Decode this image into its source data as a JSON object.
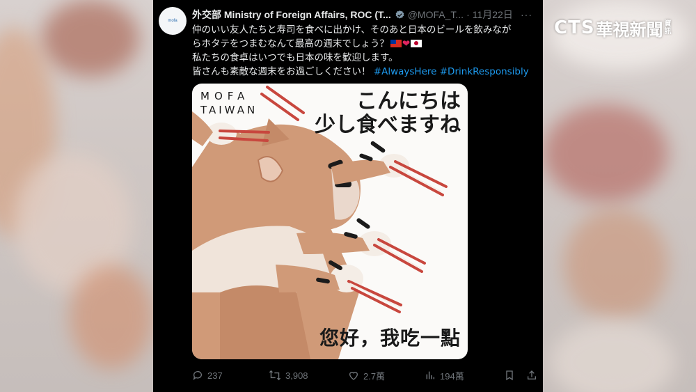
{
  "tweet": {
    "avatar_text": "mofa",
    "author_name": "外交部 Ministry of Foreign Affairs, ROC (T...",
    "handle": "@MOFA_T...",
    "separator": "·",
    "date": "11月22日",
    "more": "···",
    "lines": [
      "仲のいい友人たちと寿司を食べに出かけ、そのあと日本のビールを飲みなが",
      "らホタテをつまむなんて最高の週末でしょう？",
      "私たちの食卓はいつでも日本の味を歓迎します。",
      "皆さんも素敵な週末をお過ごしください！"
    ],
    "heart": "❤",
    "hashtags": [
      "#AlwaysHere",
      "#DrinkResponsibly"
    ]
  },
  "image": {
    "logo_line1": "MOFA",
    "logo_line2": "TAIWAN",
    "jp_line1": "こんにちは",
    "jp_line2": "少し食べますね",
    "zh_text": "您好，我吃一點"
  },
  "actions": {
    "replies": "237",
    "retweets": "3,908",
    "likes": "2.7萬",
    "views": "194萬"
  },
  "watermark": {
    "brand": "CTS",
    "name": "華視新聞",
    "small": "資訊"
  },
  "colors": {
    "background": "#000000",
    "text": "#e7e9ea",
    "muted": "#71767b",
    "link": "#1d9bf0",
    "verified": "#829aab",
    "cat_fur": "#d09a78",
    "chopstick": "#c8473e"
  },
  "icons": [
    "verified-badge-icon",
    "reply-icon",
    "retweet-icon",
    "like-icon",
    "views-icon",
    "bookmark-icon",
    "share-icon"
  ]
}
